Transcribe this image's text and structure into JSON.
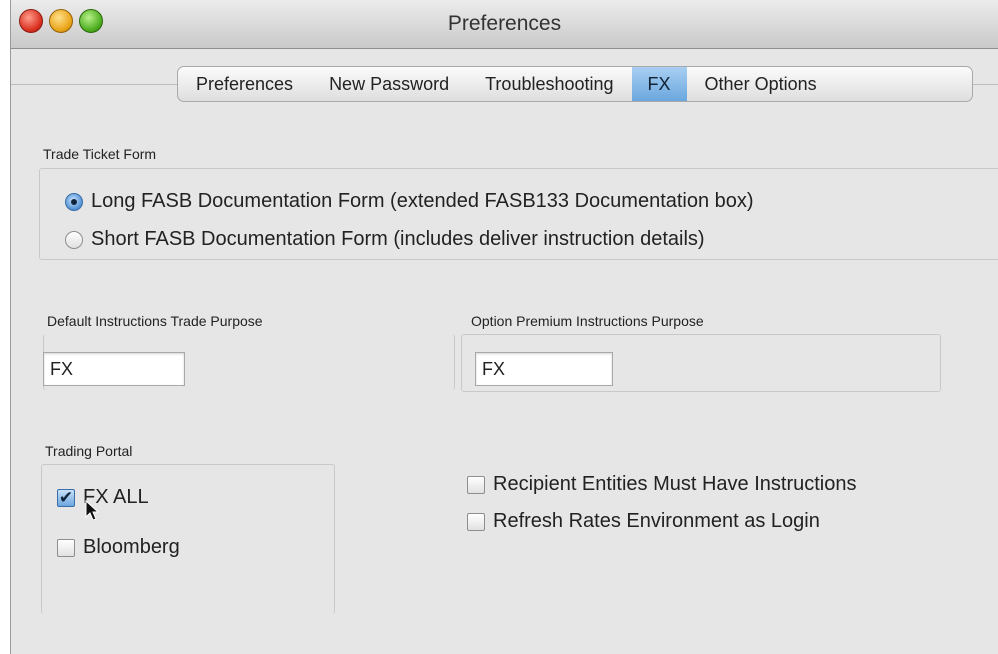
{
  "window": {
    "title": "Preferences"
  },
  "tabs": [
    {
      "label": "Preferences",
      "active": false
    },
    {
      "label": "New Password",
      "active": false
    },
    {
      "label": "Troubleshooting",
      "active": false
    },
    {
      "label": "FX",
      "active": true
    },
    {
      "label": "Other Options",
      "active": false
    }
  ],
  "trade_ticket": {
    "label": "Trade Ticket Form",
    "options": [
      {
        "label": "Long FASB Documentation Form (extended FASB133 Documentation box)",
        "selected": true
      },
      {
        "label": "Short FASB Documentation Form (includes deliver instruction details)",
        "selected": false
      }
    ]
  },
  "default_instructions": {
    "label": "Default Instructions Trade Purpose",
    "value": "FX"
  },
  "option_premium": {
    "label": "Option Premium Instructions Purpose",
    "value": "FX"
  },
  "trading_portal": {
    "label": "Trading Portal",
    "items": [
      {
        "label": "FX ALL",
        "checked": true
      },
      {
        "label": "Bloomberg",
        "checked": false
      }
    ]
  },
  "options": [
    {
      "label": "Recipient Entities Must Have Instructions",
      "checked": false
    },
    {
      "label": "Refresh Rates Environment as Login",
      "checked": false
    }
  ],
  "icons": {
    "checkmark": "✔"
  },
  "colors": {
    "active_tab": "#6aa7df",
    "selection_blue": "#4f8fd4"
  }
}
